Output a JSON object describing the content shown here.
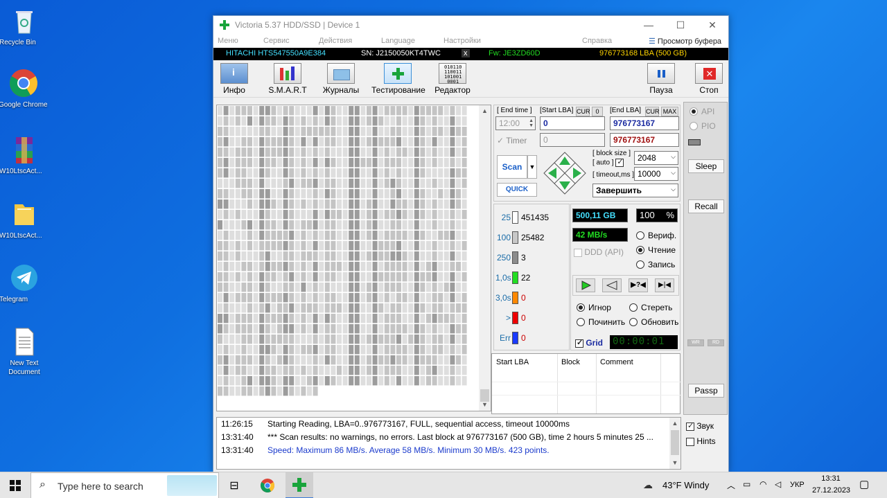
{
  "desktop": {
    "icons": [
      {
        "label": "Recycle Bin"
      },
      {
        "label": "Google Chrome"
      },
      {
        "label": "W10LtscAct..."
      },
      {
        "label": "W10LtscAct..."
      },
      {
        "label": "Telegram"
      },
      {
        "label": "New Text Document"
      }
    ]
  },
  "window": {
    "title": "Victoria 5.37 HDD/SSD | Device 1",
    "minimize": "—",
    "maximize": "☐",
    "close": "✕"
  },
  "menu": {
    "items": [
      "Меню",
      "Сервис",
      "Действия",
      "Language",
      "Настройки",
      "Справка"
    ],
    "buffer_view": "Просмотр буфера"
  },
  "drive": {
    "model": "HITACHI HTS547550A9E384",
    "serial": "SN: J2150050KT4TWC",
    "x": "x",
    "firmware": "Fw: JE3ZD60D",
    "lba": "976773168 LBA (500 GB)"
  },
  "toolbar": {
    "buttons": [
      "Инфо",
      "S.M.A.R.T",
      "Журналы",
      "Тестирование",
      "Редактор"
    ],
    "pause": "Пауза",
    "stop": "Стоп"
  },
  "test": {
    "end_time_label": "[ End time ]",
    "start_lba_label": "[Start LBA]",
    "cur1": "CUR",
    "zero": "0",
    "end_lba_label": "[End LBA]",
    "cur2": "CUR",
    "max": "MAX",
    "end_time": "12:00",
    "start_lba": "0",
    "end_lba": "976773167",
    "timer_label": "Timer",
    "timer_value": "0",
    "end_lba2": "976773167",
    "block_size_label": "[ block size ]",
    "auto_label": "[ auto ]",
    "timeout_label": "[ timeout,ms ]",
    "block_size": "2048",
    "timeout": "10000",
    "scan": "Scan",
    "quick": "QUICK",
    "finish": "Завершить"
  },
  "stats": {
    "legend": [
      {
        "n": "25",
        "count": "451435",
        "color": "#ffffff"
      },
      {
        "n": "100",
        "count": "25482",
        "color": "#c8c8c8"
      },
      {
        "n": "250",
        "count": "3",
        "color": "#8c8c8c"
      },
      {
        "n": "1,0s",
        "count": "22",
        "color": "#22dd22"
      },
      {
        "n": "3,0s",
        "count": "0",
        "color": "#ff8800"
      },
      {
        "n": ">",
        "count": "0",
        "color": "#ee0000"
      },
      {
        "n": "Err",
        "count": "0",
        "color": "#1a3aff"
      }
    ],
    "size": "500,11 GB",
    "percent": "100",
    "percent_sign": "%",
    "speed": "42 MB/s",
    "ddd": "DDD (API)",
    "verify": "Вериф.",
    "read": "Чтение",
    "write": "Запись",
    "ignore": "Игнор",
    "erase": "Стереть",
    "repair": "Починить",
    "refresh": "Обновить",
    "grid": "Grid",
    "timer": "00:00:01"
  },
  "table": {
    "headers": [
      "Start LBA",
      "Block",
      "Comment"
    ]
  },
  "side": {
    "api": "API",
    "pio": "PIO",
    "sleep": "Sleep",
    "recall": "Recall",
    "wr": "WR",
    "rd": "RD",
    "passp": "Passp",
    "sound": "Звук",
    "hints": "Hints"
  },
  "log": [
    {
      "time": "11:26:15",
      "text": "Starting Reading, LBA=0..976773167, FULL, sequential access, timeout 10000ms",
      "color": "#000000"
    },
    {
      "time": "13:31:40",
      "text": "*** Scan results: no warnings, no errors. Last block at 976773167 (500 GB), time 2 hours 5 minutes 25 ...",
      "color": "#000000"
    },
    {
      "time": "13:31:40",
      "text": "Speed: Maximum 86 MB/s. Average 58 MB/s. Minimum 30 MB/s. 423 points.",
      "color": "#1a3acc"
    }
  ],
  "taskbar": {
    "search_placeholder": "Type here to search",
    "weather": "43°F  Windy",
    "lang": "УКР",
    "time": "13:31",
    "date": "27.12.2023"
  }
}
